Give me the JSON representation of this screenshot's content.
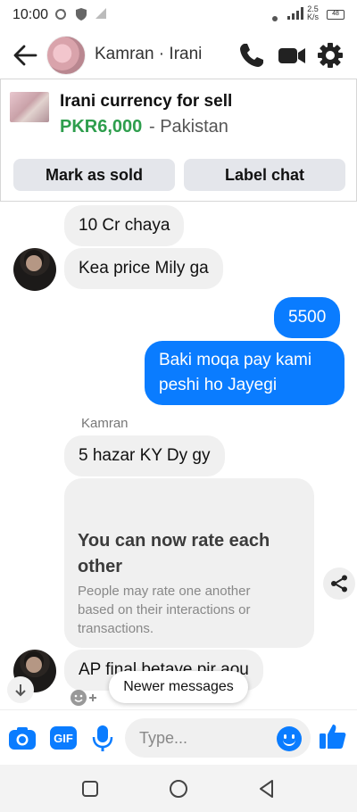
{
  "status_bar": {
    "time": "10:00",
    "net_speed_value": "2.5",
    "net_speed_unit": "K/s",
    "battery": "48"
  },
  "header": {
    "contact_name": "Kamran · Irani"
  },
  "listing": {
    "title": "Irani currency for sell",
    "price": "PKR6,000",
    "location": "- Pakistan",
    "mark_sold_label": "Mark as sold",
    "label_chat_label": "Label chat"
  },
  "messages": [
    {
      "side": "in",
      "text": "10 Cr chaya"
    },
    {
      "side": "in",
      "text": "Kea price Mily ga"
    },
    {
      "side": "out",
      "text": "5500"
    },
    {
      "side": "out",
      "text": "Baki moqa pay kami peshi ho Jayegi"
    },
    {
      "side": "in",
      "text": "5 hazar KY Dy gy"
    },
    {
      "side": "in",
      "text": "AP final betaye pir aou"
    }
  ],
  "sender_label": "Kamran",
  "rating_card": {
    "title": "You can now rate each other",
    "text": "People may rate one another based on their interactions or transactions."
  },
  "newer_messages_label": "Newer messages",
  "composer": {
    "placeholder": "Type..."
  },
  "colors": {
    "accent": "#0a7cff",
    "price_green": "#2e9e4d",
    "bubble_in": "#f0f0f0"
  }
}
